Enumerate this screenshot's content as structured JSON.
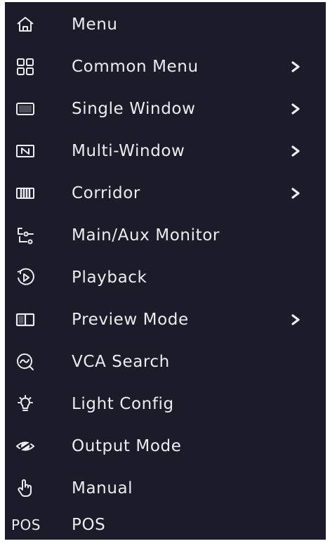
{
  "menu": {
    "items": [
      {
        "label": "Menu",
        "icon": "home-icon",
        "has_submenu": false
      },
      {
        "label": "Common Menu",
        "icon": "grid-icon",
        "has_submenu": true
      },
      {
        "label": "Single Window",
        "icon": "single-window-icon",
        "has_submenu": true
      },
      {
        "label": "Multi-Window",
        "icon": "multi-window-icon",
        "has_submenu": true
      },
      {
        "label": "Corridor",
        "icon": "corridor-icon",
        "has_submenu": true
      },
      {
        "label": "Main/Aux Monitor",
        "icon": "main-aux-monitor-icon",
        "has_submenu": false
      },
      {
        "label": "Playback",
        "icon": "playback-icon",
        "has_submenu": false
      },
      {
        "label": "Preview Mode",
        "icon": "preview-mode-icon",
        "has_submenu": true
      },
      {
        "label": "VCA Search",
        "icon": "vca-search-icon",
        "has_submenu": false
      },
      {
        "label": "Light Config",
        "icon": "light-bulb-icon",
        "has_submenu": false
      },
      {
        "label": "Output Mode",
        "icon": "output-mode-icon",
        "has_submenu": false
      },
      {
        "label": "Manual",
        "icon": "hand-icon",
        "has_submenu": false
      },
      {
        "label": "POS",
        "icon": "pos-icon",
        "icon_text": "POS",
        "has_submenu": false
      }
    ]
  },
  "colors": {
    "background": "#1b1b29",
    "text": "#ececf0",
    "page": "#ffffff"
  }
}
